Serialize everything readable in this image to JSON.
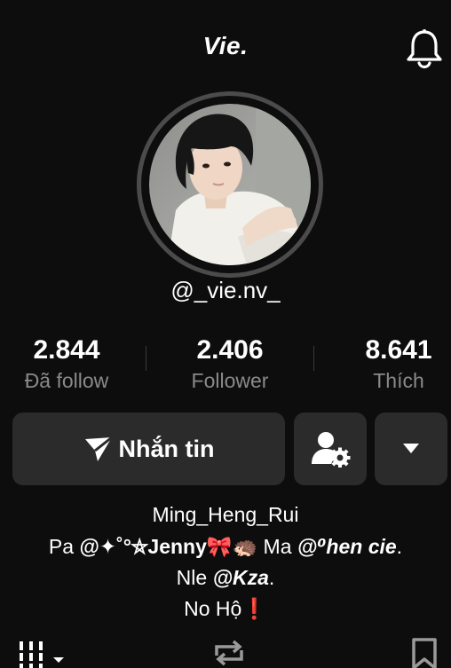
{
  "header": {
    "title": "Vie.",
    "bell_icon": "bell-icon"
  },
  "profile": {
    "username": "@_vie.nv_"
  },
  "stats": [
    {
      "value": "2.844",
      "label": "Đã follow"
    },
    {
      "value": "2.406",
      "label": "Follower"
    },
    {
      "value": "8.641",
      "label": "Thích"
    }
  ],
  "actions": {
    "message_label": "Nhắn tin",
    "message_icon": "send-icon",
    "profile_settings_icon": "user-gear-icon",
    "more_icon": "caret-down-icon"
  },
  "bio": {
    "line1": "Ming_Heng_Rui",
    "line2_pre": "Pa ",
    "line2_mention1": "@✦˚°⛤Jenny🎀🦔",
    "line2_mid": " Ma ",
    "line2_mention2": "@⁰hen cie",
    "line2_post": ".",
    "line3_pre": "Nle ",
    "line3_mention": "@Kza",
    "line3_post": ".",
    "line4": "No Hộ❗"
  },
  "tabs": {
    "grid_icon": "grid-icon",
    "repost_icon": "repost-icon",
    "bookmark_icon": "bookmark-icon"
  },
  "colors": {
    "background": "#0d0d0d",
    "button": "#2b2b2b",
    "secondary_text": "#8a8a8a",
    "accent_red": "#e0201c"
  }
}
